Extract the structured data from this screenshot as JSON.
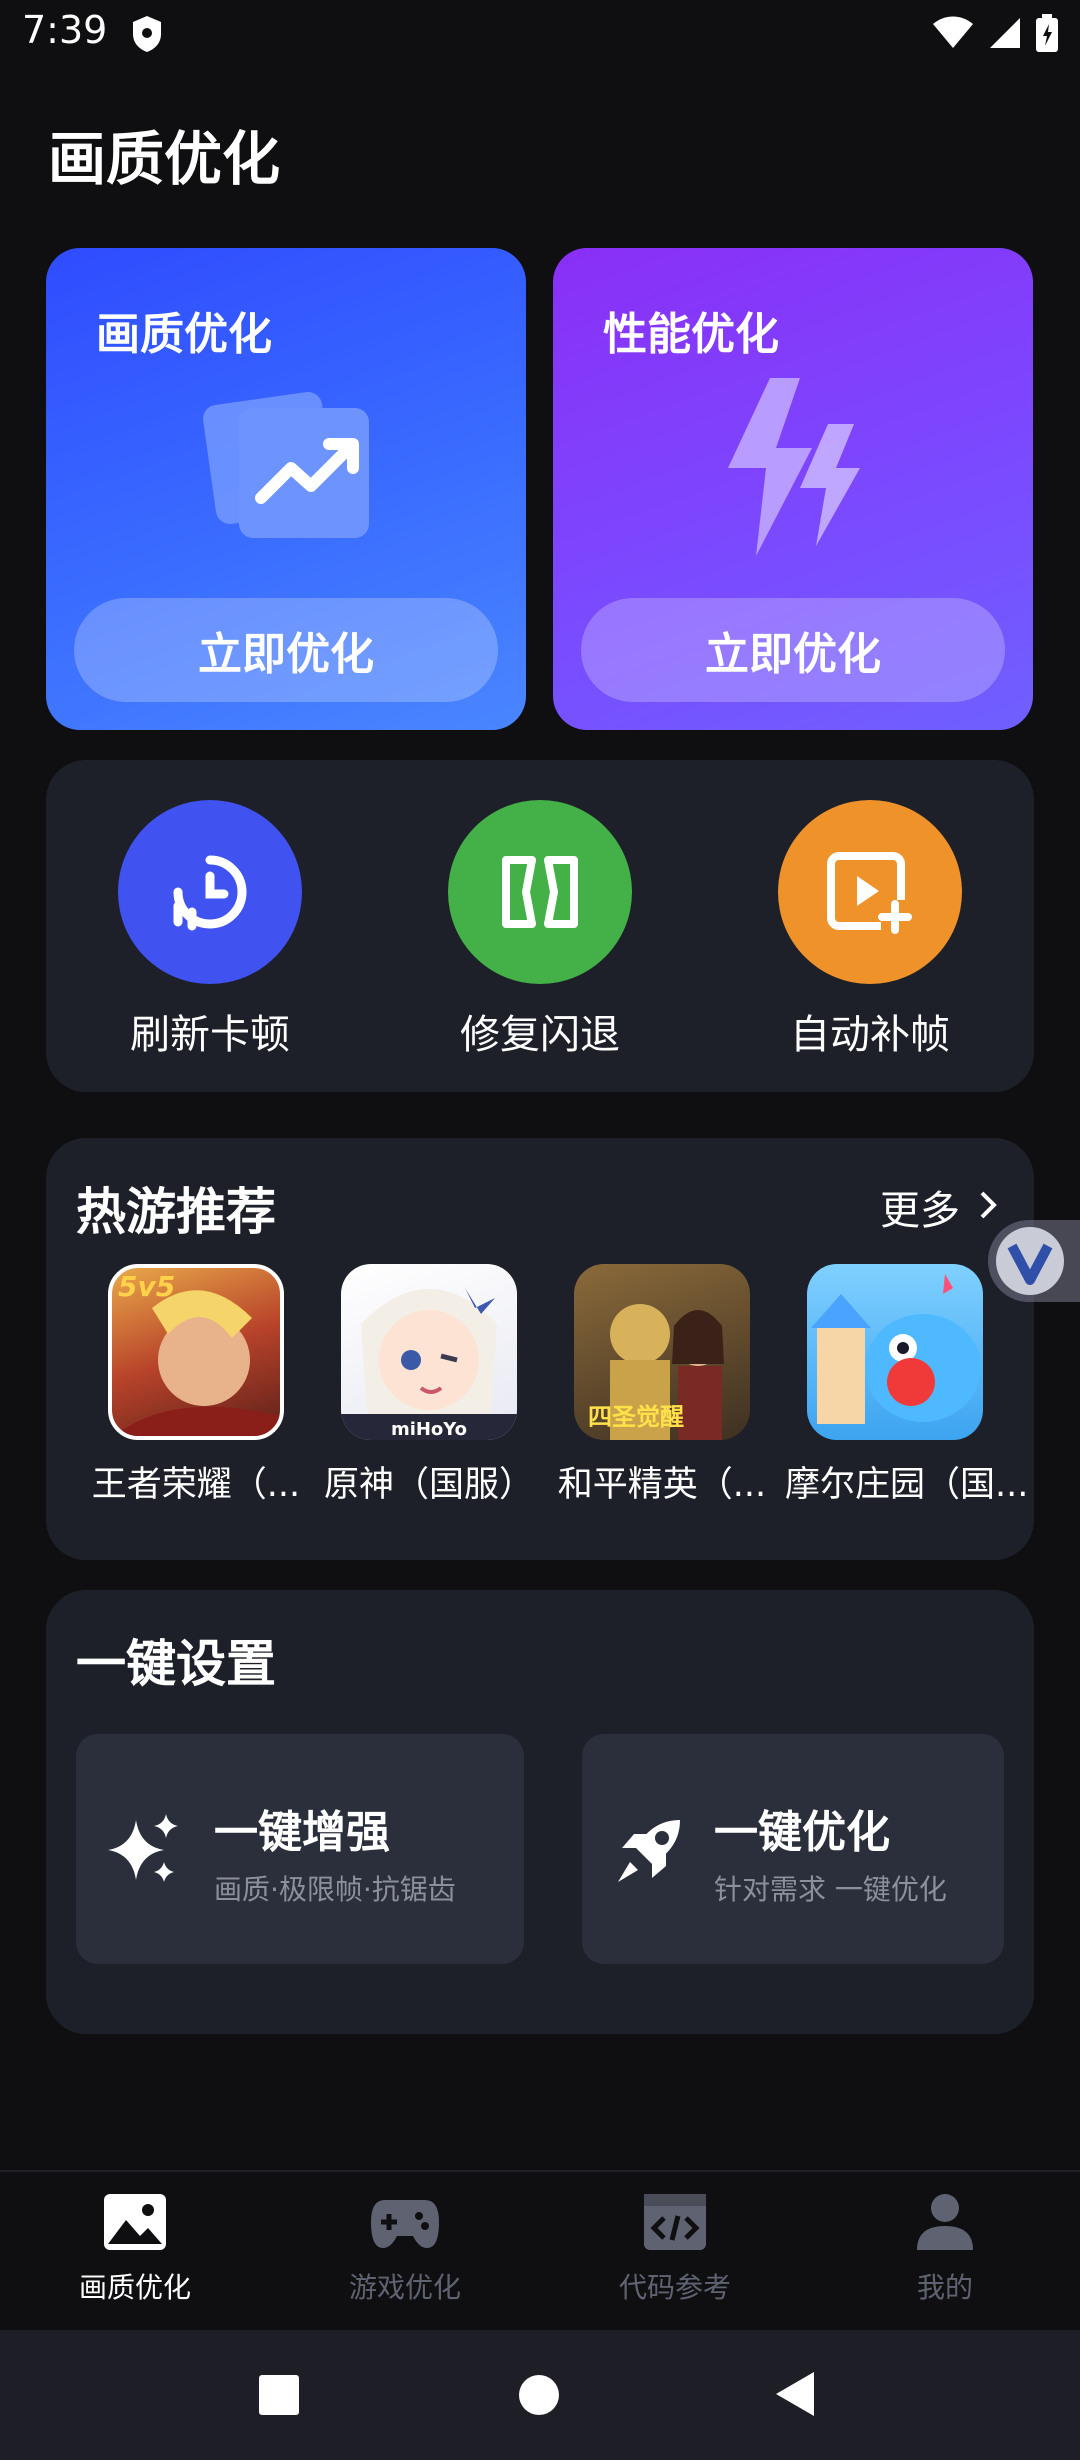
{
  "status": {
    "time": "7:39"
  },
  "page_title": "画质优化",
  "hero_cards": [
    {
      "title": "画质优化",
      "button": "立即优化",
      "icon": "trend-chart-icon",
      "color": "#3a63ff"
    },
    {
      "title": "性能优化",
      "button": "立即优化",
      "icon": "lightning-icon",
      "color": "#8040ff"
    }
  ],
  "tools": [
    {
      "label": "刷新卡顿",
      "icon": "clock-refresh-icon",
      "color": "#4052f0"
    },
    {
      "label": "修复闪退",
      "icon": "repair-frame-icon",
      "color": "#43b048"
    },
    {
      "label": "自动补帧",
      "icon": "video-add-icon",
      "color": "#f0922a"
    }
  ],
  "hot_games": {
    "title": "热游推荐",
    "more": "更多",
    "items": [
      {
        "name": "王者荣耀（...",
        "icon_text": "5v5"
      },
      {
        "name": "原神（国服）",
        "icon_text": "miHoYo"
      },
      {
        "name": "和平精英（...",
        "icon_text": "四圣觉醒"
      },
      {
        "name": "摩尔庄园（国...",
        "icon_text": ""
      }
    ]
  },
  "settings": {
    "title": "一键设置",
    "cards": [
      {
        "title": "一键增强",
        "subtitle": "画质·极限帧·抗锯齿",
        "icon": "sparkle-icon"
      },
      {
        "title": "一键优化",
        "subtitle": "针对需求 一键优化",
        "icon": "rocket-icon"
      }
    ]
  },
  "bottom_nav": [
    {
      "label": "画质优化",
      "icon": "image-icon",
      "active": true
    },
    {
      "label": "游戏优化",
      "icon": "gamepad-icon",
      "active": false
    },
    {
      "label": "代码参考",
      "icon": "code-icon",
      "active": false
    },
    {
      "label": "我的",
      "icon": "person-icon",
      "active": false
    }
  ]
}
